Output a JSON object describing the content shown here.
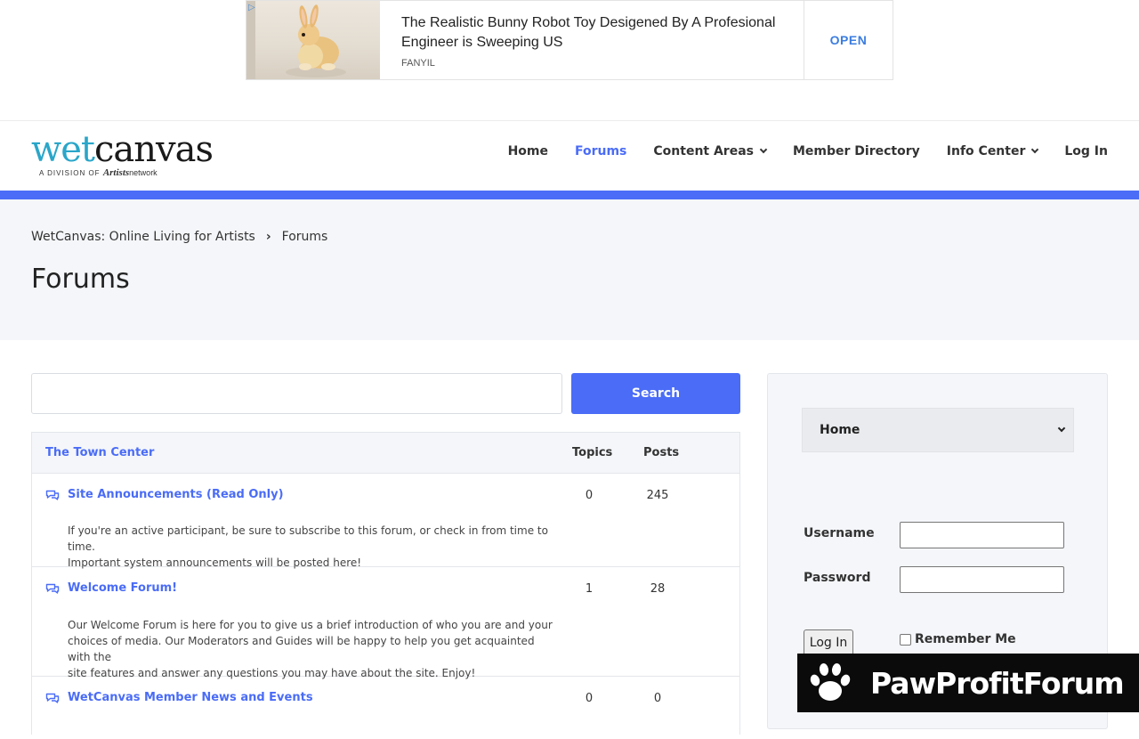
{
  "ad": {
    "headline": "The Realistic Bunny Robot Toy Desigened By A Profesional Engineer is Sweeping US",
    "brand": "FANYIL",
    "cta": "OPEN",
    "image_icon": "bunny-toy-image"
  },
  "header": {
    "logo_wet": "wet",
    "logo_canvas": "canvas",
    "logo_sub_prefix": "A DIVISION OF",
    "logo_sub_brand": "Artists",
    "logo_sub_suffix": "network",
    "nav": [
      {
        "label": "Home"
      },
      {
        "label": "Forums"
      },
      {
        "label": "Content Areas"
      },
      {
        "label": "Member Directory"
      },
      {
        "label": "Info Center"
      },
      {
        "label": "Log In"
      }
    ],
    "accent_color": "#4a6cf7"
  },
  "breadcrumb": {
    "root": "WetCanvas: Online Living for Artists",
    "separator": "›",
    "current": "Forums"
  },
  "page_title": "Forums",
  "search": {
    "placeholder": "",
    "button_label": "Search"
  },
  "forum_table": {
    "category": "The Town Center",
    "col_topics": "Topics",
    "col_posts": "Posts",
    "rows": [
      {
        "title": "Site Announcements (Read Only)",
        "desc_lines": [
          "If you're an active participant, be sure to subscribe to this forum, or check in from time to time.",
          "Important system announcements will be posted here!"
        ],
        "topics": "0",
        "posts": "245"
      },
      {
        "title": "Welcome Forum!",
        "desc_lines": [
          "Our Welcome Forum is here for you to give us a brief introduction of who you are and your",
          "choices of media. Our Moderators and Guides will be happy to help you get acquainted with the",
          "site features and answer any questions you may have about the site. Enjoy!"
        ],
        "topics": "1",
        "posts": "28"
      },
      {
        "title": "WetCanvas Member News and Events",
        "desc_lines": [],
        "topics": "0",
        "posts": "0"
      }
    ]
  },
  "sidebar": {
    "select_value": "Home",
    "username_label": "Username",
    "password_label": "Password",
    "login_button": "Log In",
    "remember_label": "Remember Me"
  },
  "watermark": {
    "text": "PawProfitForum",
    "icon": "paw-icon"
  }
}
